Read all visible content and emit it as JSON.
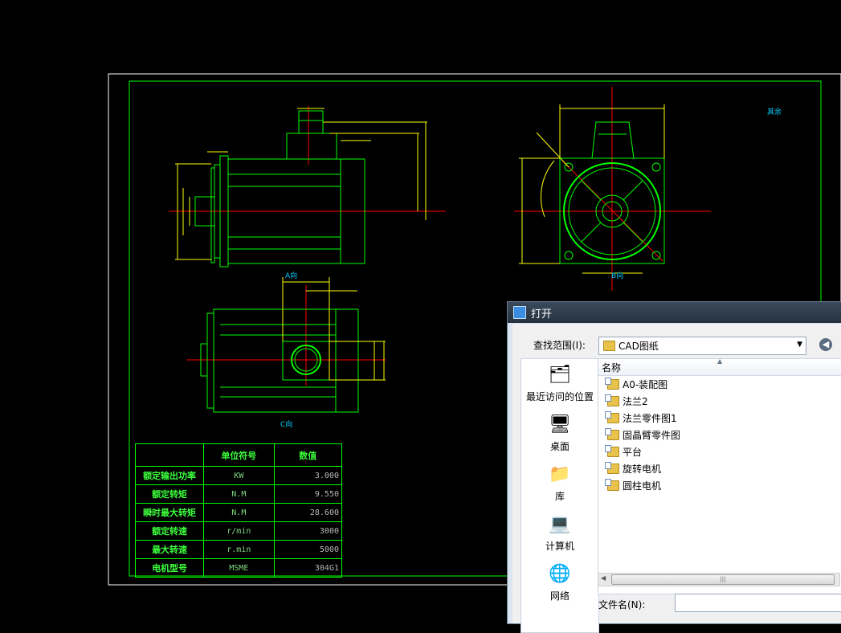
{
  "drawing": {
    "view_labels": [
      "A向",
      "B向",
      "C向"
    ],
    "note": "其余",
    "table": {
      "header": [
        "",
        "单位符号",
        "数值"
      ],
      "rows": [
        {
          "name": "额定输出功率",
          "unit": "KW",
          "value": "3.000"
        },
        {
          "name": "额定转矩",
          "unit": "N.M",
          "value": "9.550"
        },
        {
          "name": "瞬时最大转矩",
          "unit": "N.M",
          "value": "28.600"
        },
        {
          "name": "额定转速",
          "unit": "r/min",
          "value": "3000"
        },
        {
          "name": "最大转速",
          "unit": "r.min",
          "value": "5000"
        },
        {
          "name": "电机型号",
          "unit": "MSME",
          "value": "304G1"
        }
      ]
    }
  },
  "dialog": {
    "title": "打开",
    "look_in_label": "查找范围(I):",
    "look_in_value": "CAD图纸",
    "places": [
      {
        "label": "最近访问的位置",
        "icon": "recent-places-icon"
      },
      {
        "label": "桌面",
        "icon": "desktop-icon"
      },
      {
        "label": "库",
        "icon": "library-icon"
      },
      {
        "label": "计算机",
        "icon": "computer-icon"
      },
      {
        "label": "网络",
        "icon": "network-icon"
      }
    ],
    "column_name": "名称",
    "files": [
      "A0-装配图",
      "法兰2",
      "法兰零件图1",
      "固晶臂零件图",
      "平台",
      "旋转电机",
      "圆柱电机"
    ],
    "filename_label": "文件名(N):",
    "filename_value": ""
  },
  "colors": {
    "drawing_line": "#00ff00",
    "outline": "#ffffff",
    "centerline": "#ff0000",
    "dimension": "#ffff00"
  }
}
